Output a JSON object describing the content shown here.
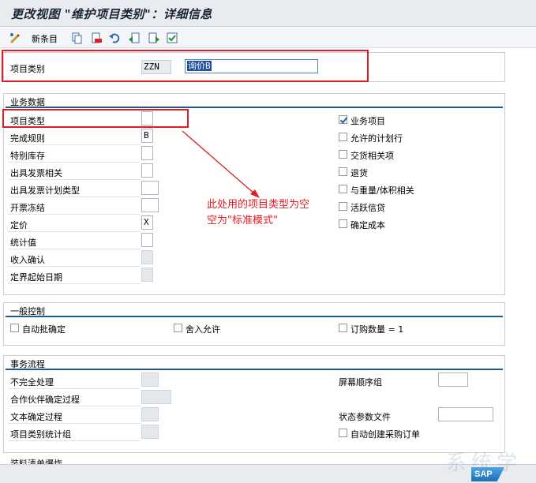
{
  "window": {
    "title": "更改视图 \"维护项目类别\"：详细信息"
  },
  "toolbar": {
    "new_entries_label": "新条目"
  },
  "key": {
    "label": "项目类别",
    "code": "ZZN",
    "description": "询价B"
  },
  "business": {
    "title": "业务数据",
    "left": [
      {
        "label": "项目类型",
        "value": ""
      },
      {
        "label": "完成规则",
        "value": "B"
      },
      {
        "label": "特别库存",
        "value": ""
      },
      {
        "label": "出具发票相关",
        "value": ""
      },
      {
        "label": "出具发票计划类型",
        "value": ""
      },
      {
        "label": "开票冻结",
        "value": ""
      },
      {
        "label": "定价",
        "value": "X"
      },
      {
        "label": "统计值",
        "value": ""
      },
      {
        "label": "收入确认",
        "value": ""
      },
      {
        "label": "定界起始日期",
        "value": ""
      }
    ],
    "checkboxes": [
      {
        "label": "业务项目",
        "checked": true
      },
      {
        "label": "允许的计划行",
        "checked": false
      },
      {
        "label": "交货相关项",
        "checked": false
      },
      {
        "label": "退货",
        "checked": false
      },
      {
        "label": "与重量/体积相关",
        "checked": false
      },
      {
        "label": "活跃信贷",
        "checked": false
      },
      {
        "label": "确定成本",
        "checked": false
      }
    ]
  },
  "annotation": {
    "line1": "此处用的项目类型为空",
    "line2": "空为\"标准模式\""
  },
  "general": {
    "title": "一般控制",
    "auto_batch": "自动批确定",
    "rounding": "舍入允许",
    "order_qty": "订购数量 = 1"
  },
  "flow": {
    "title": "事务流程",
    "incomplete": "不完全处理",
    "partner": "合作伙伴确定过程",
    "text": "文本确定过程",
    "stat_group": "项目类别统计组",
    "screen_seq": "屏幕顺序组",
    "status_profile": "状态参数文件",
    "auto_po": "自动创建采购订单"
  },
  "bottom": {
    "partial_title": "装料清单爆炸"
  },
  "footer": {
    "logo": "SAP",
    "watermark": "系统学"
  }
}
